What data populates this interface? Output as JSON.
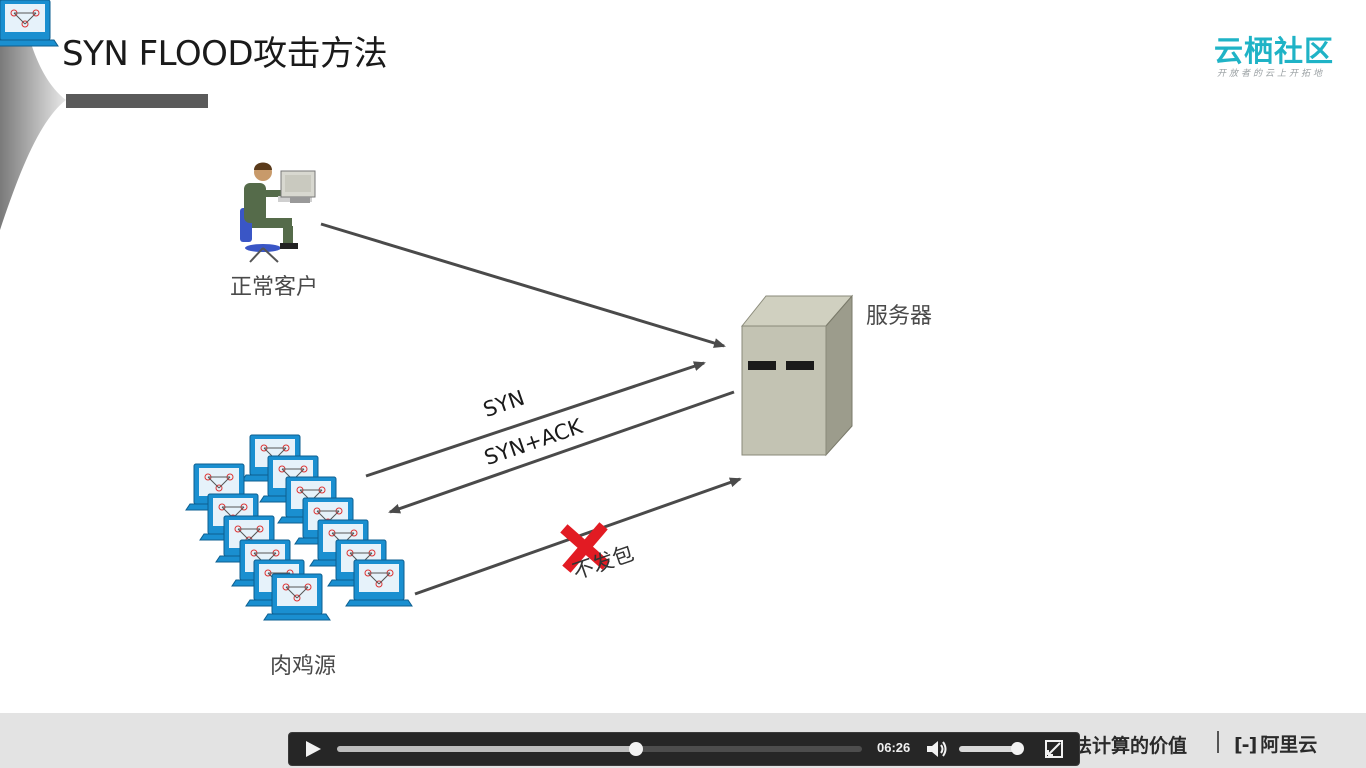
{
  "slide": {
    "title": "SYN FLOOD攻击方法",
    "brand": "云栖社区",
    "brand_tagline": "开放者的云上开拓地",
    "colors": {
      "brand": "#1fb3c6",
      "arrow": "#4a4a4a",
      "cross": "#e21b23",
      "footer": "#e3e3e3"
    }
  },
  "diagram": {
    "client_label": "正常客户",
    "server_label": "服务器",
    "botnet_label": "肉鸡源",
    "arrow_syn": "SYN",
    "arrow_synack": "SYN+ACK",
    "arrow_blocked": "不发包",
    "icons": [
      "person-at-computer-icon",
      "server-tower-icon",
      "botnet-terminals-icon",
      "red-x-icon"
    ]
  },
  "footer": {
    "slogan": "为了无法计算的价值",
    "logo_mark": "[-]",
    "logo_text": "阿里云"
  },
  "player": {
    "time": "06:26",
    "progress": 0.57,
    "volume": 0.9,
    "icons": [
      "play-icon",
      "volume-icon",
      "fullscreen-icon"
    ]
  }
}
